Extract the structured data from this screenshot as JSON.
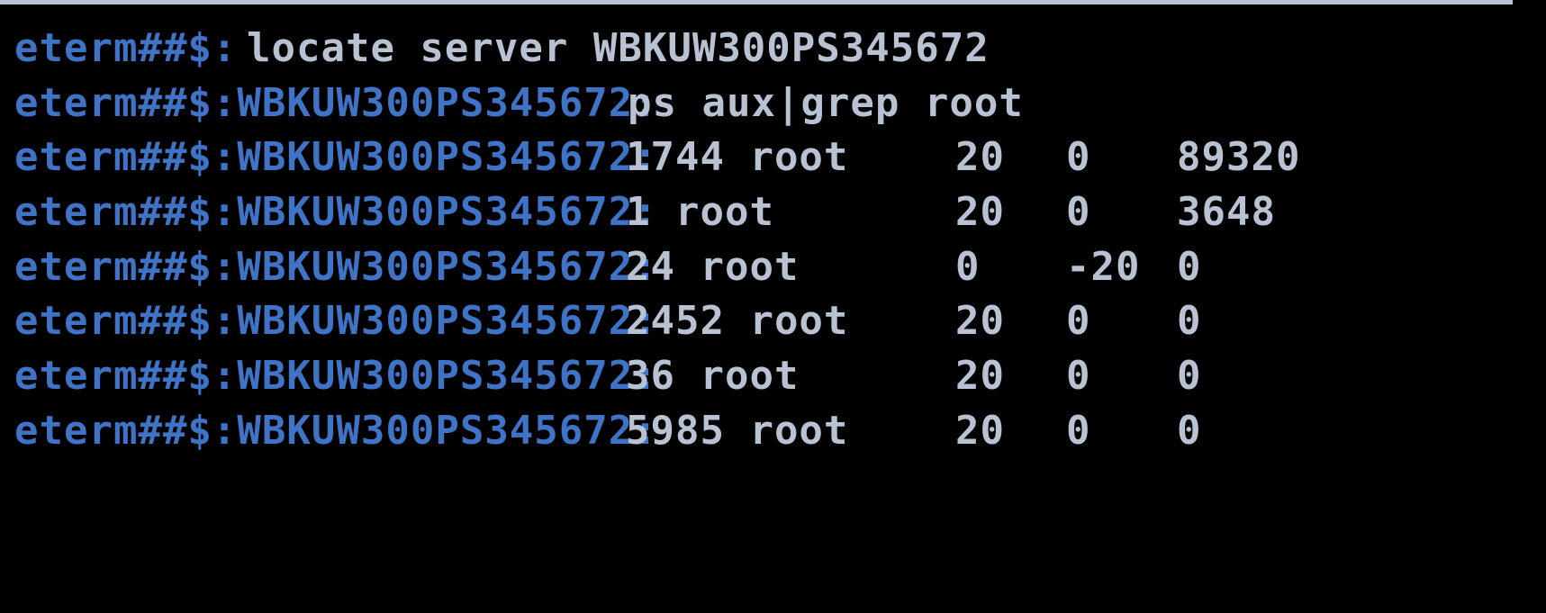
{
  "terminal": {
    "colors": {
      "background": "#000000",
      "prompt": "#3f73c6",
      "text": "#b8c2d2",
      "border": "#b9c4d6"
    },
    "lines": [
      {
        "prompt": "eterm##$:",
        "command": "locate server WBKUW300PS345672"
      },
      {
        "prompt": "eterm##$:WBKUW300PS345672:",
        "command": "ps aux|grep root"
      }
    ],
    "process_rows": [
      {
        "prompt": "eterm##$:WBKUW300PS345672:",
        "pid_user": "1744 root",
        "pr": "20",
        "ni": "0",
        "virt": "89320"
      },
      {
        "prompt": "eterm##$:WBKUW300PS345672:",
        "pid_user": "1 root",
        "pr": "20",
        "ni": "0",
        "virt": "3648"
      },
      {
        "prompt": "eterm##$:WBKUW300PS345672:",
        "pid_user": "24 root",
        "pr": "0",
        "ni": "-20",
        "virt": "0"
      },
      {
        "prompt": "eterm##$:WBKUW300PS345672:",
        "pid_user": "2452 root",
        "pr": "20",
        "ni": "0",
        "virt": "0"
      },
      {
        "prompt": "eterm##$:WBKUW300PS345672:",
        "pid_user": "36 root",
        "pr": "20",
        "ni": "0",
        "virt": "0"
      },
      {
        "prompt": "eterm##$:WBKUW300PS345672:",
        "pid_user": "5985 root",
        "pr": "20",
        "ni": "0",
        "virt": "0"
      }
    ]
  }
}
